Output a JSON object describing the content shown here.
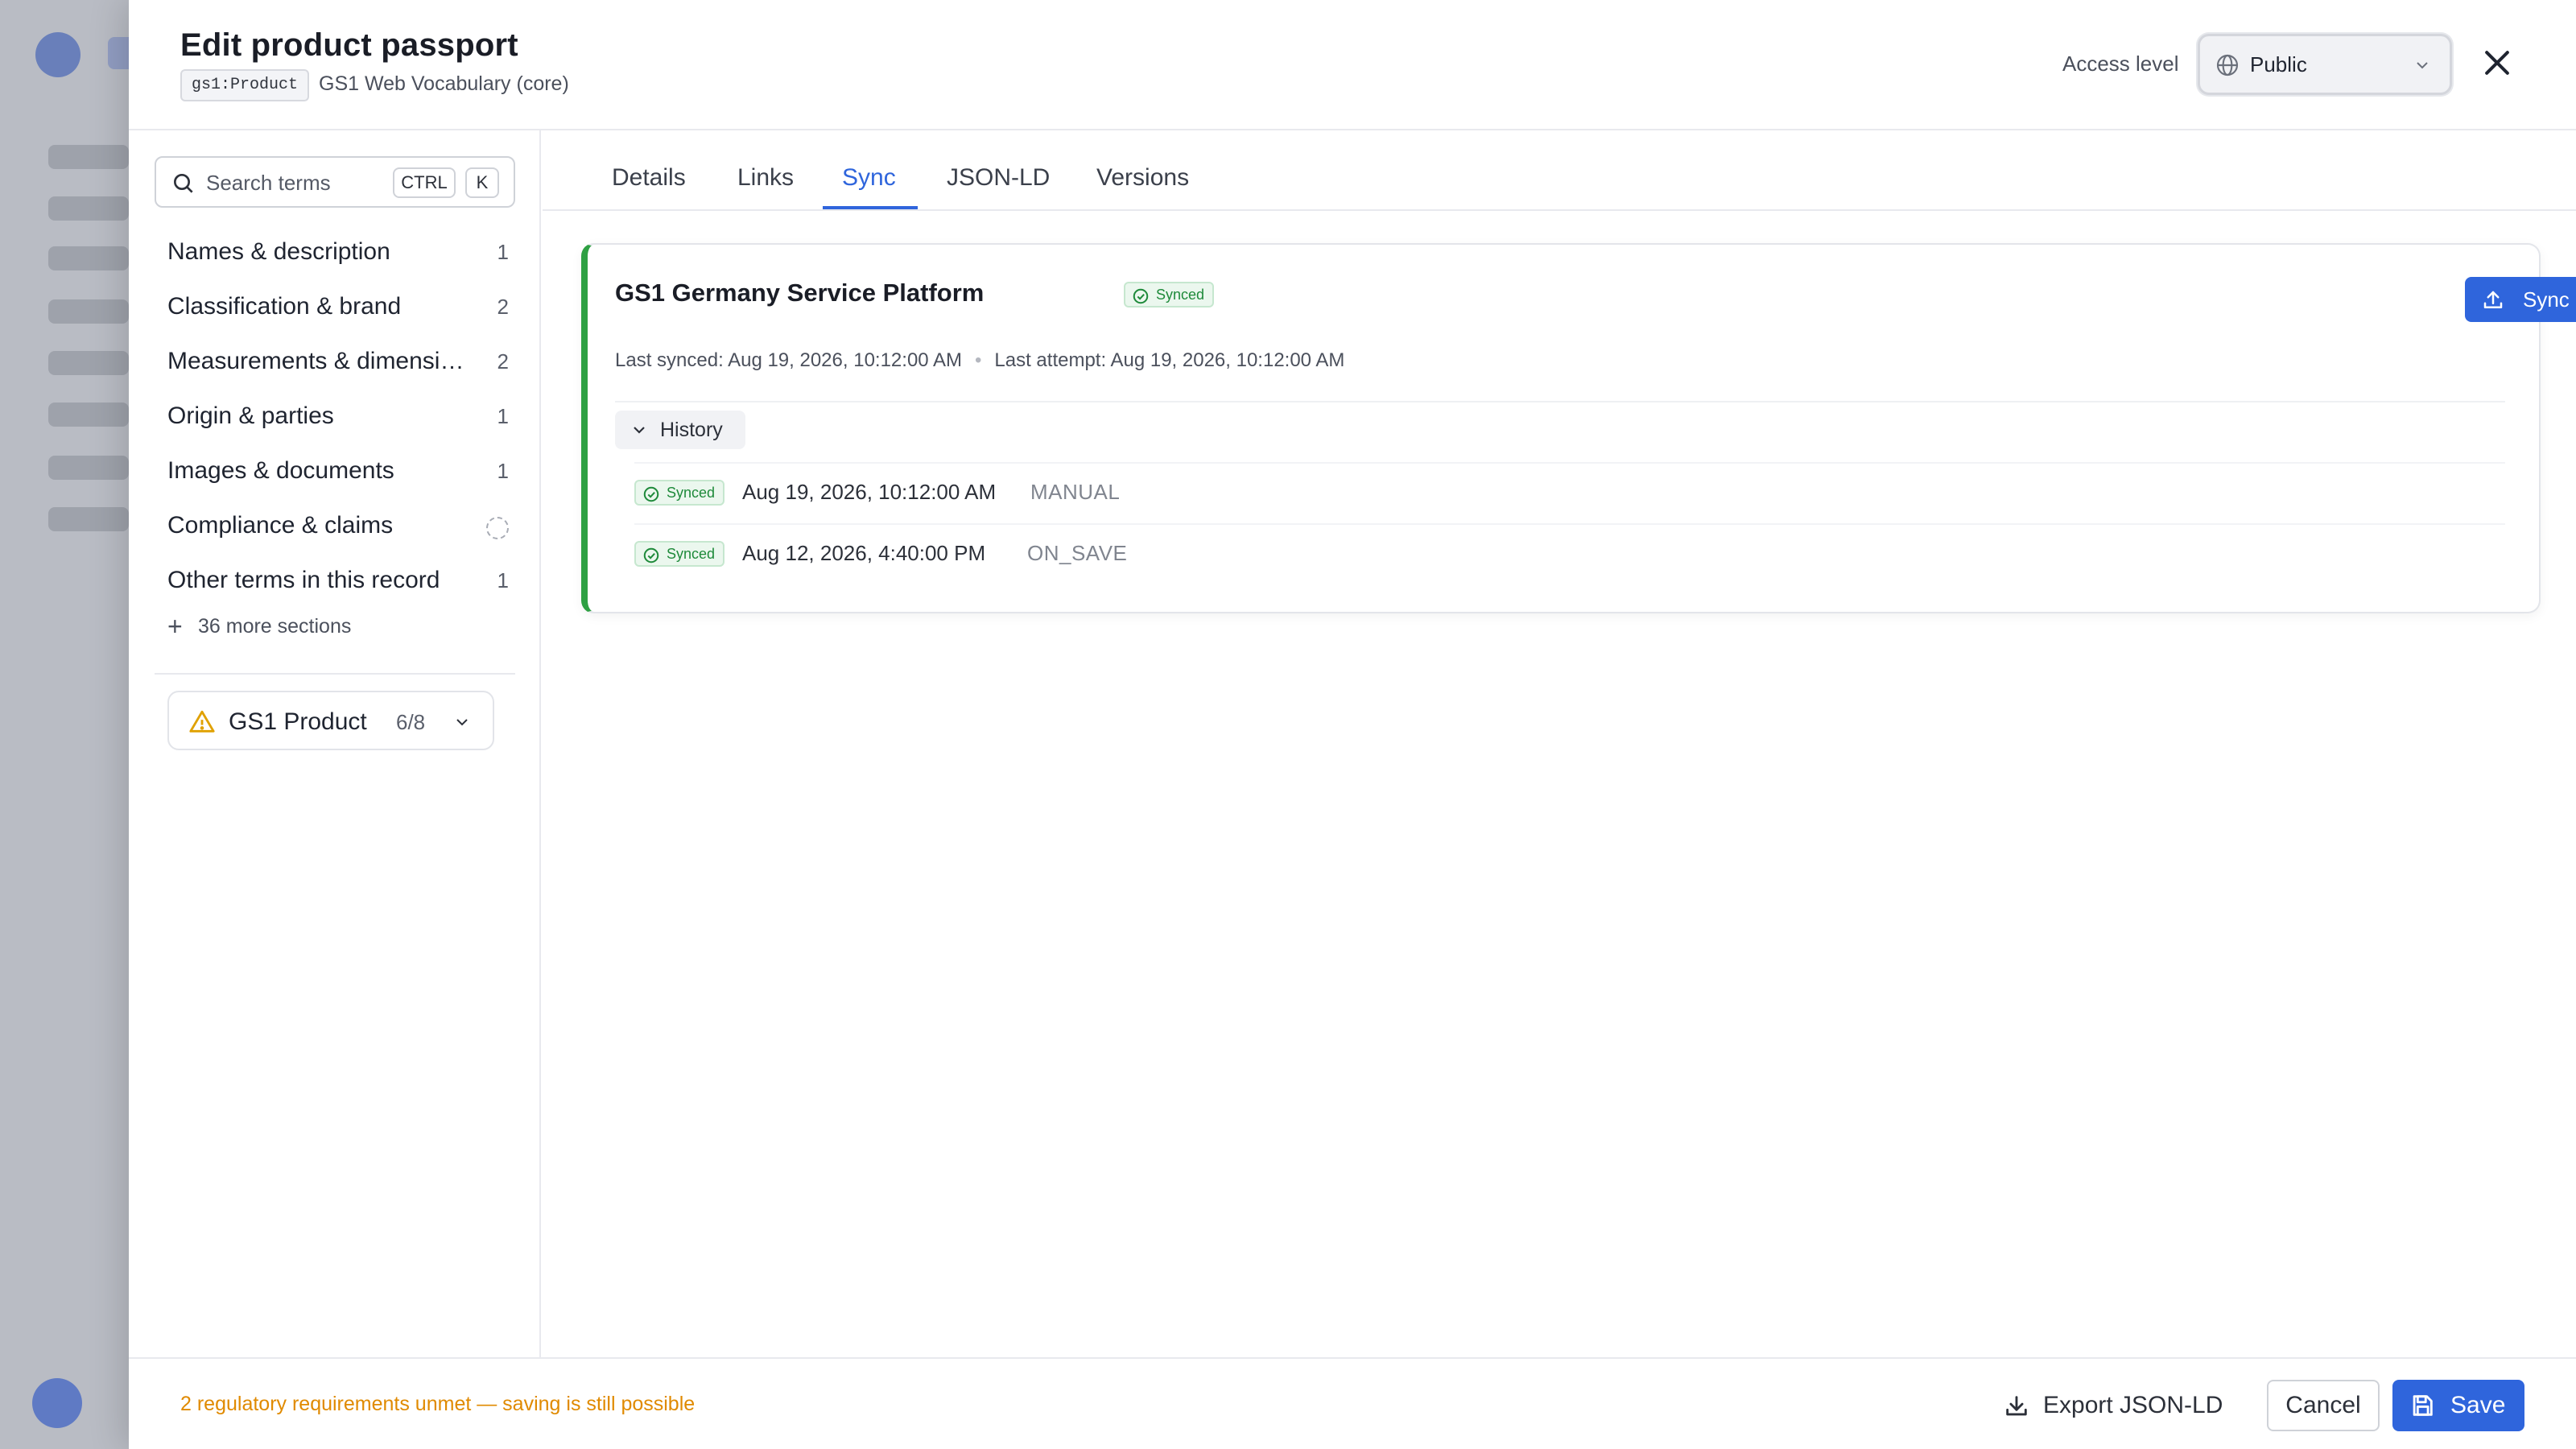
{
  "header": {
    "title": "Edit product passport",
    "type_chip": "gs1:Product",
    "vocabulary": "GS1 Web Vocabulary (core)",
    "access_label": "Access level",
    "access_value": "Public"
  },
  "search": {
    "placeholder": "Search terms",
    "shortcut_mod": "CTRL",
    "shortcut_key": "K"
  },
  "sections": [
    {
      "label": "Names & description",
      "count": "1"
    },
    {
      "label": "Classification & brand",
      "count": "2"
    },
    {
      "label": "Measurements & dimensions",
      "count": "2"
    },
    {
      "label": "Origin & parties",
      "count": "1"
    },
    {
      "label": "Images & documents",
      "count": "1"
    },
    {
      "label": "Compliance & claims",
      "count": ""
    },
    {
      "label": "Other terms in this record",
      "count": "1"
    }
  ],
  "more_sections": "36 more sections",
  "profile": {
    "name": "GS1 Product",
    "ratio": "6/8"
  },
  "tabs": [
    {
      "label": "Details"
    },
    {
      "label": "Links"
    },
    {
      "label": "Sync"
    },
    {
      "label": "JSON-LD"
    },
    {
      "label": "Versions"
    }
  ],
  "active_tab": "Sync",
  "sync": {
    "platform": "GS1 Germany Service Platform",
    "status": "Synced",
    "sync_button": "Sync now",
    "last_synced": "Last synced: Aug 19, 2026, 10:12:00 AM",
    "last_attempt": "Last attempt: Aug 19, 2026, 10:12:00 AM",
    "history_label": "History",
    "history": [
      {
        "status": "Synced",
        "time": "Aug 19, 2026, 10:12:00 AM",
        "trigger": "MANUAL"
      },
      {
        "status": "Synced",
        "time": "Aug 12, 2026, 4:40:00 PM",
        "trigger": "ON_SAVE"
      }
    ]
  },
  "footer": {
    "message": "2 regulatory requirements unmet — saving is still possible",
    "export_label": "Export JSON-LD",
    "cancel_label": "Cancel",
    "save_label": "Save"
  },
  "colors": {
    "accent": "#2f65dc",
    "success": "#2ea043",
    "warning": "#e08a00"
  }
}
